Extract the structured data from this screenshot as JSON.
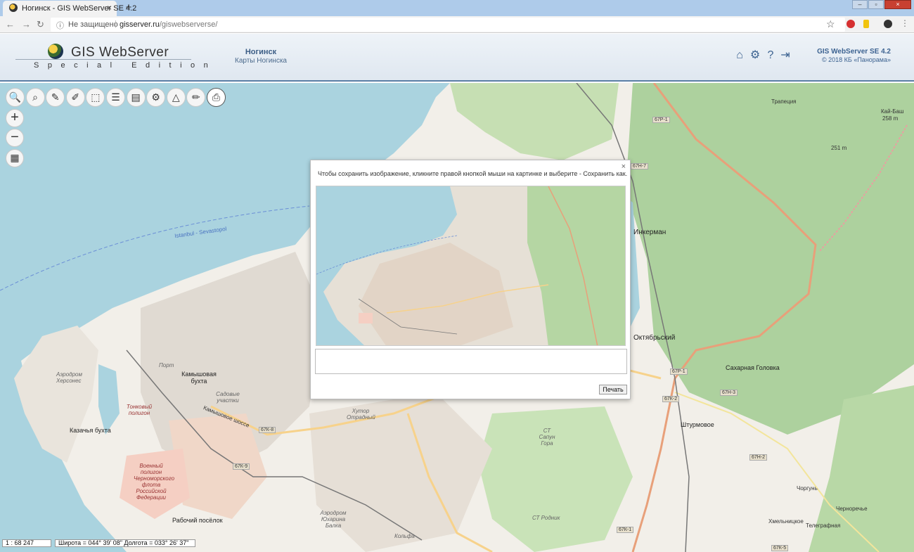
{
  "browser": {
    "tab_title": "Ногинск - GIS WebServer SE 4.2",
    "tab_close": "×",
    "new_tab": "+",
    "security_text": "Не защищено",
    "url_host": "gisserver.ru",
    "url_path": "/giswebserverse/",
    "window_controls": [
      "–",
      "▫",
      "×"
    ]
  },
  "header": {
    "logo_text": "GIS WebServer",
    "logo_subtitle": "Special Edition",
    "project_title": "Ногинск",
    "project_subtitle": "Карты Ногинска",
    "icons": [
      "home-icon",
      "gear-icon",
      "help-icon",
      "login-icon"
    ],
    "product": "GIS WebServer SE 4.2",
    "copyright": "© 2018 КБ «Панорама»"
  },
  "toolbar": {
    "tools": [
      {
        "name": "search-icon",
        "glyph": "🔍"
      },
      {
        "name": "area-search-icon",
        "glyph": "⌕"
      },
      {
        "name": "measure-icon",
        "glyph": "✎"
      },
      {
        "name": "clear-measure-icon",
        "glyph": "✐"
      },
      {
        "name": "clear-selection-icon",
        "glyph": "⬚"
      },
      {
        "name": "layers-icon",
        "glyph": "☰"
      },
      {
        "name": "map-legend-icon",
        "glyph": "▤"
      },
      {
        "name": "settings-icon",
        "glyph": "⚙"
      },
      {
        "name": "objects-icon",
        "glyph": "△"
      },
      {
        "name": "edit-icon",
        "glyph": "✏"
      },
      {
        "name": "print-icon",
        "glyph": "⎙"
      }
    ],
    "zoom_in": "+",
    "zoom_out": "−",
    "map_icon": "▦"
  },
  "dialog": {
    "message": "Чтобы сохранить изображение, кликните правой кнопкой мыши на картинке и выберите - Сохранить как...",
    "close": "×",
    "comment_value": "",
    "print_label": "Печать"
  },
  "map": {
    "labels": [
      "Istanbul - Sevastopol",
      "Трапеция",
      "Кай-Баш",
      "258 m",
      "251 m",
      "Инкерман",
      "Октябрьский",
      "Сахарная Головка",
      "Штурмовое",
      "Черноречье",
      "Хмельницкое",
      "Телеграфная",
      "Камышовая бухта",
      "Казачья бухта",
      "Аэродром Херсонес",
      "Тонковый полигон",
      "Военный полигон Черноморского флота Российской Федерации",
      "Рабочий посёлок",
      "Хутор Отрадный",
      "Аэродром Юхарина Балка",
      "СТ Сапун Гора",
      "СТ Родник",
      "Садовые участки",
      "Порт",
      "Кольфа",
      "Чоргунь",
      "Камышовое шоссе"
    ],
    "shields": [
      "67Р-1",
      "67Н-7",
      "67К-8",
      "67К-9",
      "67К-2",
      "67Н-3",
      "67Р-1",
      "67Н-2",
      "67К-1",
      "67К-5"
    ]
  },
  "status": {
    "scale": "1 : 68 247",
    "coords": "Широта = 044° 39' 08\" Долгота = 033° 26' 37\""
  },
  "colors": {
    "sea": "#aad3df",
    "land": "#f2efe9",
    "forest": "#add19e",
    "accent": "#3d6391"
  }
}
